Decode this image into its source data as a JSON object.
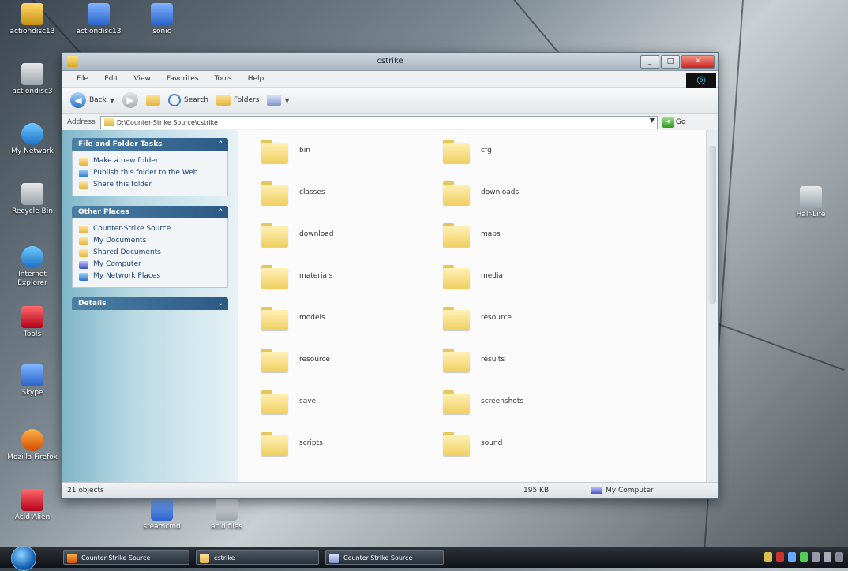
{
  "desktop": {
    "icons": [
      {
        "label": "actiondisc13"
      },
      {
        "label": "actiondisc13"
      },
      {
        "label": "sonic"
      },
      {
        "label": "actiondisc3"
      },
      {
        "label": "My Network"
      },
      {
        "label": "Recycle Bin"
      },
      {
        "label": "Internet Explorer"
      },
      {
        "label": "Tools"
      },
      {
        "label": "Skype"
      },
      {
        "label": "Mozilla Firefox"
      },
      {
        "label": "Acid Alien"
      },
      {
        "label": "steamcmd"
      },
      {
        "label": "acid files"
      },
      {
        "label": "Half-Life"
      }
    ]
  },
  "window": {
    "title": "cstrike",
    "buttons": {
      "min": "_",
      "max": "□",
      "close": "✕"
    },
    "menu": [
      "File",
      "Edit",
      "View",
      "Favorites",
      "Tools",
      "Help"
    ],
    "toolbar": {
      "back": "Back",
      "search": "Search",
      "folders": "Folders"
    },
    "address": {
      "label": "Address",
      "path": "D:\\Counter-Strike Source\\cstrike",
      "go": "Go"
    },
    "tasks": {
      "file_folder_tasks": {
        "title": "File and Folder Tasks",
        "items": [
          "Make a new folder",
          "Publish this folder to the Web",
          "Share this folder"
        ]
      },
      "other_places": {
        "title": "Other Places",
        "items": [
          "Counter-Strike Source",
          "My Documents",
          "Shared Documents",
          "My Computer",
          "My Network Places"
        ]
      },
      "details": {
        "title": "Details"
      }
    },
    "folders": [
      "bin",
      "cfg",
      "classes",
      "downloads",
      "download",
      "maps",
      "materials",
      "media",
      "models",
      "resource",
      "resource",
      "results",
      "save",
      "screenshots",
      "scripts",
      "sound"
    ],
    "status": {
      "objects": "21 objects",
      "size": "195 KB",
      "location": "My Computer"
    }
  },
  "taskbar": {
    "buttons": [
      "Counter-Strike Source",
      "cstrike",
      "Counter-Strike Source"
    ]
  }
}
